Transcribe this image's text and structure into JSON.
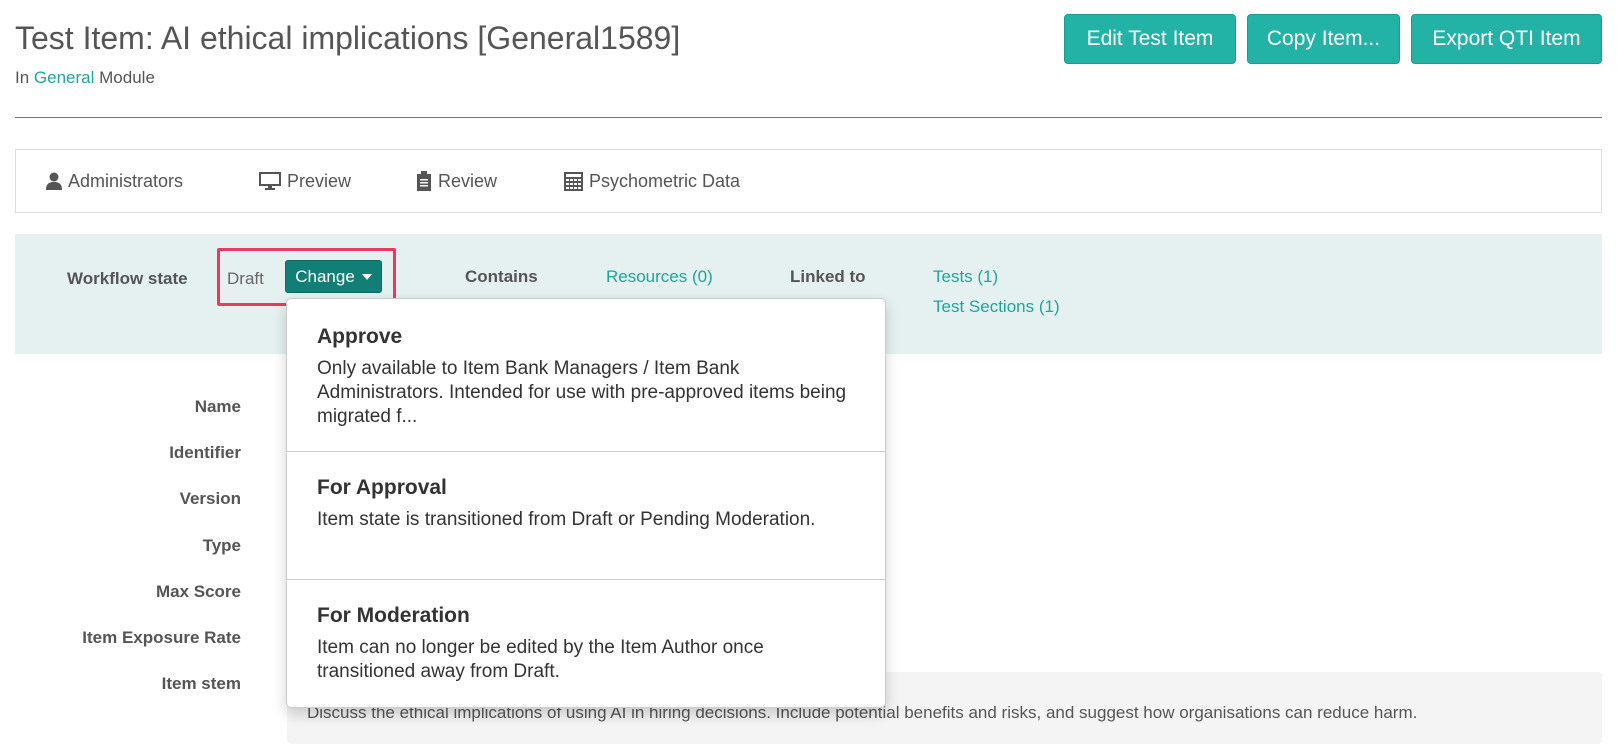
{
  "header": {
    "title": "Test Item: AI ethical implications [General1589]",
    "module_prefix": "In",
    "module_link": "General",
    "module_suffix": "Module",
    "buttons": {
      "edit": "Edit Test Item",
      "copy": "Copy Item...",
      "export": "Export QTI Item"
    }
  },
  "tabs": [
    {
      "label": "Administrators",
      "icon": "user-icon"
    },
    {
      "label": "Preview",
      "icon": "monitor-icon"
    },
    {
      "label": "Review",
      "icon": "clipboard-icon"
    },
    {
      "label": "Psychometric Data",
      "icon": "calculator-icon"
    }
  ],
  "workflow": {
    "state_label": "Workflow state",
    "state_value": "Draft",
    "change_button": "Change",
    "contains_label": "Contains",
    "resources_link": "Resources (0)",
    "linked_label": "Linked to",
    "tests_link": "Tests (1)",
    "sections_link": "Test Sections (1)"
  },
  "fields": {
    "name": "Name",
    "identifier": "Identifier",
    "version": "Version",
    "type": "Type",
    "max_score": "Max Score",
    "exposure": "Item Exposure Rate",
    "item_stem": "Item stem"
  },
  "item_stem_text": "Discuss the ethical implications of using AI in hiring decisions. Include potential benefits and risks, and suggest how organisations can reduce harm.",
  "dropdown": {
    "items": [
      {
        "title": "Approve",
        "description": "Only available to Item Bank Managers / Item Bank Administrators. Intended for use with pre-approved items being migrated f..."
      },
      {
        "title": "For Approval",
        "description": "Item state is transitioned from Draft or Pending Moderation."
      },
      {
        "title": "For Moderation",
        "description": "Item can no longer be edited by the Item Author once transitioned away from Draft."
      }
    ]
  },
  "colors": {
    "accent": "#22b2a6",
    "change_button": "#127f76",
    "workflow_bg": "#e5f1f1",
    "highlight": "#e63b5e",
    "link": "#1fa59a"
  }
}
